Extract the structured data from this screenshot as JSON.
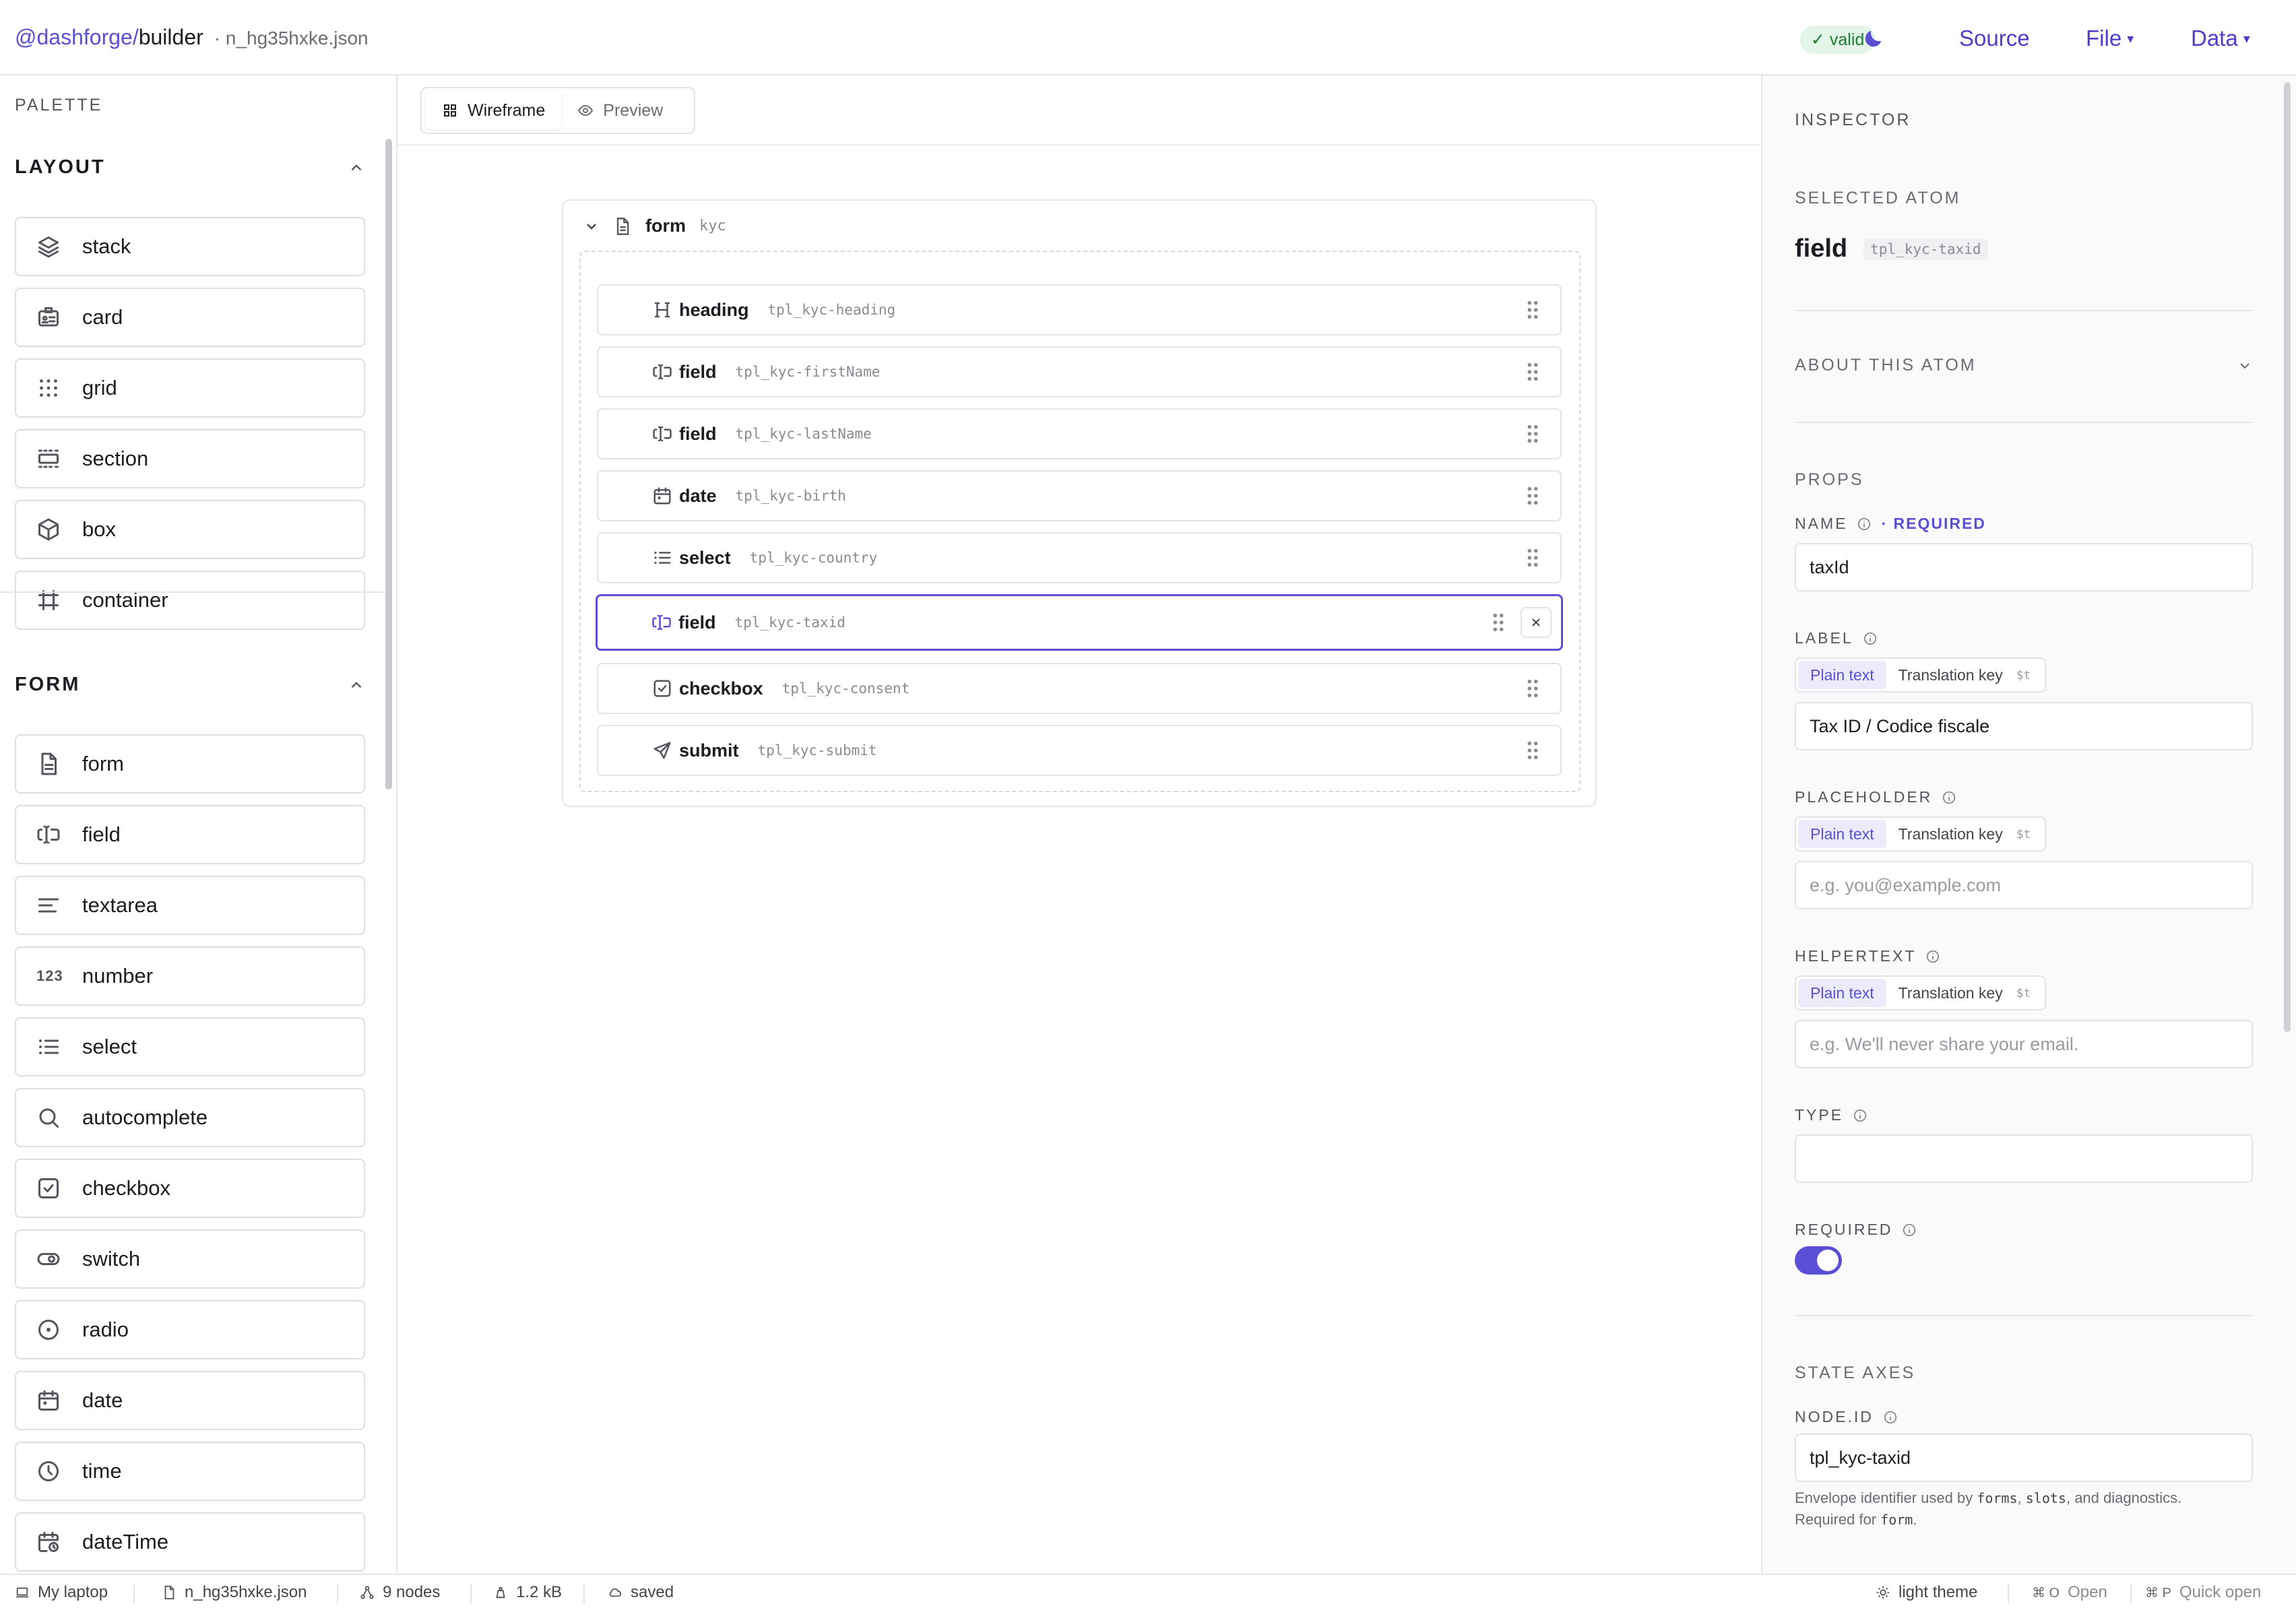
{
  "topbar": {
    "scope": "@dashforge/",
    "app": "builder",
    "file": "· n_hg35hxke.json",
    "valid_label": "✓ valid",
    "theme_icon": "moon-icon",
    "menus": {
      "source": "Source",
      "file": "File",
      "data": "Data",
      "caret": "▾"
    }
  },
  "palette": {
    "title": "PALETTE",
    "groups": [
      {
        "name": "LAYOUT",
        "items": [
          {
            "label": "stack",
            "icon": "layers-icon"
          },
          {
            "label": "card",
            "icon": "id-card-icon"
          },
          {
            "label": "grid",
            "icon": "grid-dots-icon"
          },
          {
            "label": "section",
            "icon": "section-icon"
          },
          {
            "label": "box",
            "icon": "cube-icon"
          },
          {
            "label": "container",
            "icon": "frame-icon"
          }
        ]
      },
      {
        "name": "FORM",
        "items": [
          {
            "label": "form",
            "icon": "document-icon"
          },
          {
            "label": "field",
            "icon": "text-cursor-input-icon"
          },
          {
            "label": "textarea",
            "icon": "align-left-icon"
          },
          {
            "label": "number",
            "icon": "number-123-icon",
            "glyph": "123"
          },
          {
            "label": "select",
            "icon": "list-icon"
          },
          {
            "label": "autocomplete",
            "icon": "search-icon"
          },
          {
            "label": "checkbox",
            "icon": "checkbox-icon"
          },
          {
            "label": "switch",
            "icon": "toggle-icon"
          },
          {
            "label": "radio",
            "icon": "radio-icon"
          },
          {
            "label": "date",
            "icon": "calendar-icon"
          },
          {
            "label": "time",
            "icon": "clock-icon"
          },
          {
            "label": "dateTime",
            "icon": "calendar-clock-icon"
          }
        ]
      }
    ]
  },
  "canvas": {
    "tabs": [
      {
        "label": "Wireframe",
        "icon": "wireframe-grid-icon",
        "active": true
      },
      {
        "label": "Preview",
        "icon": "eye-icon",
        "active": false
      }
    ],
    "form": {
      "name": "form",
      "id": "kyc",
      "rows": [
        {
          "name": "heading",
          "id": "tpl_kyc-heading",
          "icon": "heading-icon"
        },
        {
          "name": "field",
          "id": "tpl_kyc-firstName",
          "icon": "text-cursor-input-icon"
        },
        {
          "name": "field",
          "id": "tpl_kyc-lastName",
          "icon": "text-cursor-input-icon"
        },
        {
          "name": "date",
          "id": "tpl_kyc-birth",
          "icon": "calendar-icon"
        },
        {
          "name": "select",
          "id": "tpl_kyc-country",
          "icon": "list-icon"
        },
        {
          "name": "field",
          "id": "tpl_kyc-taxid",
          "icon": "text-cursor-input-icon",
          "selected": true
        },
        {
          "name": "checkbox",
          "id": "tpl_kyc-consent",
          "icon": "checkbox-icon"
        },
        {
          "name": "submit",
          "id": "tpl_kyc-submit",
          "icon": "send-icon"
        }
      ]
    }
  },
  "inspector": {
    "title": "INSPECTOR",
    "selected_heading": "SELECTED ATOM",
    "atom_name": "field",
    "atom_id": "tpl_kyc-taxid",
    "about": "ABOUT THIS ATOM",
    "props_heading": "PROPS",
    "name_label": "NAME",
    "required_tag": "· REQUIRED",
    "name_value": "taxId",
    "label_label": "LABEL",
    "label_value": "Tax ID / Codice fiscale",
    "placeholder_label": "PLACEHOLDER",
    "placeholder_value": "e.g. you@example.com",
    "helper_label": "HELPERTEXT",
    "helper_value": "e.g. We'll never share your email.",
    "type_label": "TYPE",
    "type_value": "",
    "required_label": "REQUIRED",
    "required_on": true,
    "seg_plain": "Plain text",
    "seg_key": "Translation key",
    "seg_kbd": "$t",
    "state_heading": "STATE AXES",
    "nodeid_label": "NODE.ID",
    "nodeid_value": "tpl_kyc-taxid",
    "help": {
      "p1": "Envelope identifier used by ",
      "c1": "forms",
      "p2": ", ",
      "c2": "slots",
      "p3": ", and diagnostics.",
      "p4": "Required for ",
      "c3": "form",
      "p5": "."
    }
  },
  "statusbar": {
    "machine": "My laptop",
    "file": "n_hg35hxke.json",
    "nodes": "9 nodes",
    "size": "1.2 kB",
    "saved": "saved",
    "theme": "light theme",
    "open_key": "⌘ O",
    "open_label": "Open",
    "quick_key": "⌘ P",
    "quick_label": "Quick open"
  },
  "colors": {
    "accent": "#5b4fd6",
    "valid_bg": "#e3f5e6",
    "valid_fg": "#1e7a33"
  }
}
